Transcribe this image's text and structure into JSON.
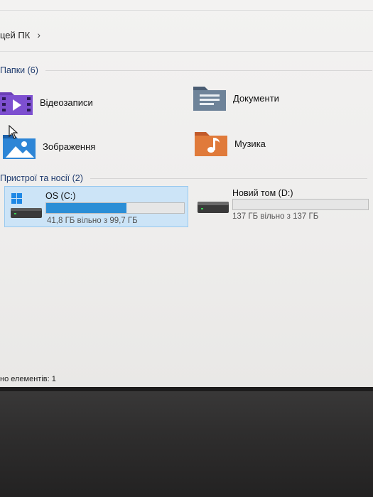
{
  "address": {
    "location": "цей ПК",
    "chevron": "›"
  },
  "sections": {
    "folders_title": "Папки (6)",
    "devices_title": "Пристрої та носії (2)"
  },
  "folders": [
    {
      "label": "Відеозаписи",
      "icon": "videos-folder-icon"
    },
    {
      "label": "Документи",
      "icon": "documents-folder-icon"
    },
    {
      "label": "Зображення",
      "icon": "pictures-folder-icon"
    },
    {
      "label": "Музика",
      "icon": "music-folder-icon"
    }
  ],
  "drives": [
    {
      "name": "OS (C:)",
      "free_text": "41,8 ГБ вільно з 99,7 ГБ",
      "used_fraction": 0.58,
      "fill_color": "#2b8ed6",
      "selected": true
    },
    {
      "name": "Новий том (D:)",
      "free_text": "137 ГБ вільно з 137 ГБ",
      "used_fraction": 0.0,
      "fill_color": "#2b8ed6",
      "selected": false
    }
  ],
  "status": {
    "text": "но елементів: 1"
  }
}
